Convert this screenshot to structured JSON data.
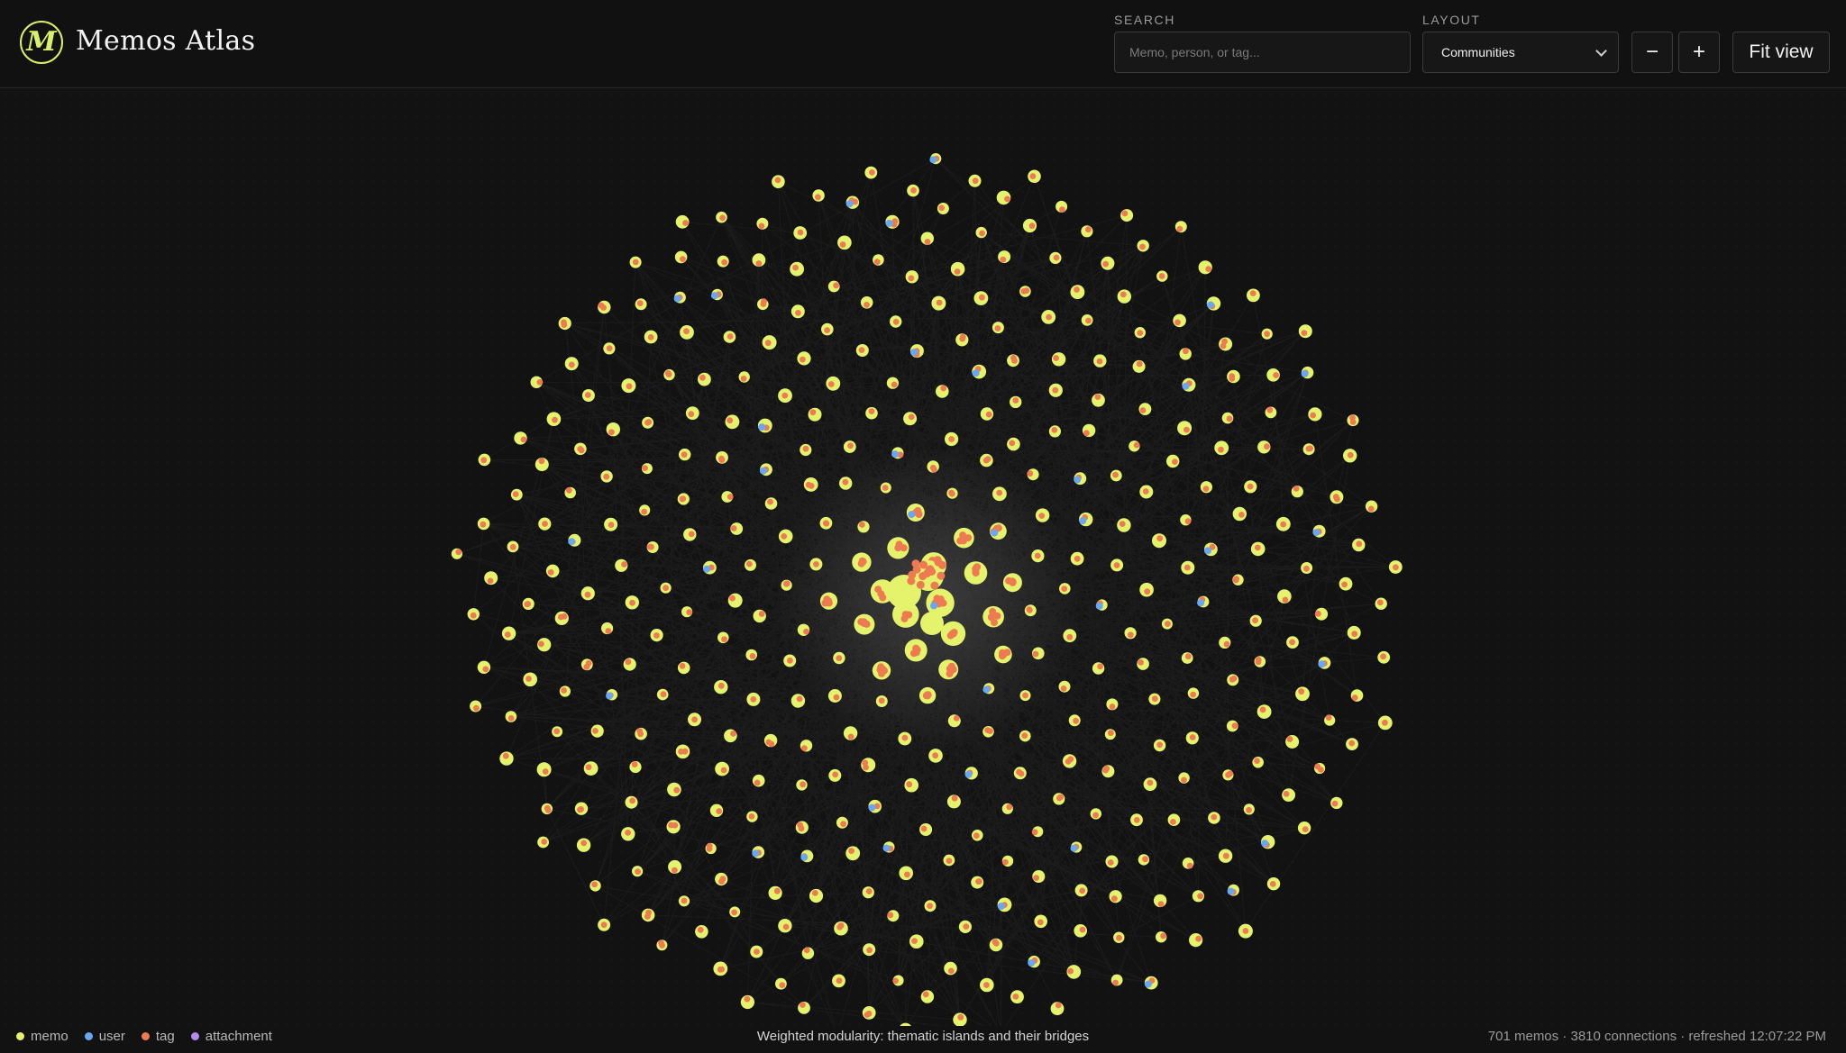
{
  "app": {
    "title": "Memos Atlas",
    "logo_letter": "M"
  },
  "controls": {
    "search": {
      "label": "SEARCH",
      "placeholder": "Memo, person, or tag...",
      "value": ""
    },
    "layout": {
      "label": "LAYOUT",
      "selected": "Communities"
    },
    "zoom_out_label": "−",
    "zoom_in_label": "+",
    "fit_label": "Fit view"
  },
  "legend": [
    {
      "label": "memo",
      "color": "#e4f36b"
    },
    {
      "label": "user",
      "color": "#6aa7f2"
    },
    {
      "label": "tag",
      "color": "#ee7a52"
    },
    {
      "label": "attachment",
      "color": "#b48af0"
    }
  ],
  "caption": "Weighted modularity: thematic islands and their bridges",
  "stats": "701 memos · 3810 connections · refreshed 12:07:22 PM",
  "colors": {
    "memo": "#e4f36b",
    "user": "#6aa7f2",
    "tag": "#ee7a52",
    "attachment": "#b48af0",
    "background": "#121212",
    "edge": "#9a9a9a"
  }
}
